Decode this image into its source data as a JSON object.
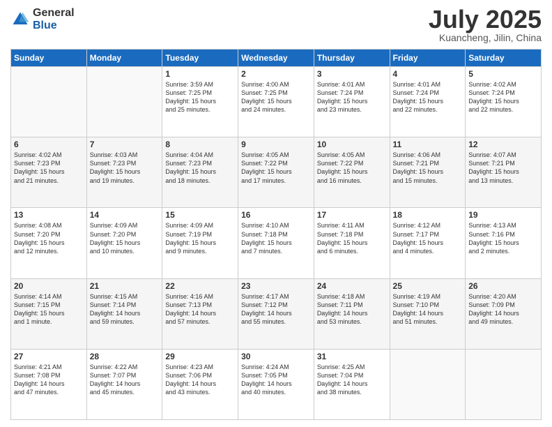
{
  "logo": {
    "general": "General",
    "blue": "Blue"
  },
  "header": {
    "month": "July 2025",
    "location": "Kuancheng, Jilin, China"
  },
  "days_of_week": [
    "Sunday",
    "Monday",
    "Tuesday",
    "Wednesday",
    "Thursday",
    "Friday",
    "Saturday"
  ],
  "weeks": [
    [
      {
        "day": "",
        "info": ""
      },
      {
        "day": "",
        "info": ""
      },
      {
        "day": "1",
        "info": "Sunrise: 3:59 AM\nSunset: 7:25 PM\nDaylight: 15 hours\nand 25 minutes."
      },
      {
        "day": "2",
        "info": "Sunrise: 4:00 AM\nSunset: 7:25 PM\nDaylight: 15 hours\nand 24 minutes."
      },
      {
        "day": "3",
        "info": "Sunrise: 4:01 AM\nSunset: 7:24 PM\nDaylight: 15 hours\nand 23 minutes."
      },
      {
        "day": "4",
        "info": "Sunrise: 4:01 AM\nSunset: 7:24 PM\nDaylight: 15 hours\nand 22 minutes."
      },
      {
        "day": "5",
        "info": "Sunrise: 4:02 AM\nSunset: 7:24 PM\nDaylight: 15 hours\nand 22 minutes."
      }
    ],
    [
      {
        "day": "6",
        "info": "Sunrise: 4:02 AM\nSunset: 7:23 PM\nDaylight: 15 hours\nand 21 minutes."
      },
      {
        "day": "7",
        "info": "Sunrise: 4:03 AM\nSunset: 7:23 PM\nDaylight: 15 hours\nand 19 minutes."
      },
      {
        "day": "8",
        "info": "Sunrise: 4:04 AM\nSunset: 7:23 PM\nDaylight: 15 hours\nand 18 minutes."
      },
      {
        "day": "9",
        "info": "Sunrise: 4:05 AM\nSunset: 7:22 PM\nDaylight: 15 hours\nand 17 minutes."
      },
      {
        "day": "10",
        "info": "Sunrise: 4:05 AM\nSunset: 7:22 PM\nDaylight: 15 hours\nand 16 minutes."
      },
      {
        "day": "11",
        "info": "Sunrise: 4:06 AM\nSunset: 7:21 PM\nDaylight: 15 hours\nand 15 minutes."
      },
      {
        "day": "12",
        "info": "Sunrise: 4:07 AM\nSunset: 7:21 PM\nDaylight: 15 hours\nand 13 minutes."
      }
    ],
    [
      {
        "day": "13",
        "info": "Sunrise: 4:08 AM\nSunset: 7:20 PM\nDaylight: 15 hours\nand 12 minutes."
      },
      {
        "day": "14",
        "info": "Sunrise: 4:09 AM\nSunset: 7:20 PM\nDaylight: 15 hours\nand 10 minutes."
      },
      {
        "day": "15",
        "info": "Sunrise: 4:09 AM\nSunset: 7:19 PM\nDaylight: 15 hours\nand 9 minutes."
      },
      {
        "day": "16",
        "info": "Sunrise: 4:10 AM\nSunset: 7:18 PM\nDaylight: 15 hours\nand 7 minutes."
      },
      {
        "day": "17",
        "info": "Sunrise: 4:11 AM\nSunset: 7:18 PM\nDaylight: 15 hours\nand 6 minutes."
      },
      {
        "day": "18",
        "info": "Sunrise: 4:12 AM\nSunset: 7:17 PM\nDaylight: 15 hours\nand 4 minutes."
      },
      {
        "day": "19",
        "info": "Sunrise: 4:13 AM\nSunset: 7:16 PM\nDaylight: 15 hours\nand 2 minutes."
      }
    ],
    [
      {
        "day": "20",
        "info": "Sunrise: 4:14 AM\nSunset: 7:15 PM\nDaylight: 15 hours\nand 1 minute."
      },
      {
        "day": "21",
        "info": "Sunrise: 4:15 AM\nSunset: 7:14 PM\nDaylight: 14 hours\nand 59 minutes."
      },
      {
        "day": "22",
        "info": "Sunrise: 4:16 AM\nSunset: 7:13 PM\nDaylight: 14 hours\nand 57 minutes."
      },
      {
        "day": "23",
        "info": "Sunrise: 4:17 AM\nSunset: 7:12 PM\nDaylight: 14 hours\nand 55 minutes."
      },
      {
        "day": "24",
        "info": "Sunrise: 4:18 AM\nSunset: 7:11 PM\nDaylight: 14 hours\nand 53 minutes."
      },
      {
        "day": "25",
        "info": "Sunrise: 4:19 AM\nSunset: 7:10 PM\nDaylight: 14 hours\nand 51 minutes."
      },
      {
        "day": "26",
        "info": "Sunrise: 4:20 AM\nSunset: 7:09 PM\nDaylight: 14 hours\nand 49 minutes."
      }
    ],
    [
      {
        "day": "27",
        "info": "Sunrise: 4:21 AM\nSunset: 7:08 PM\nDaylight: 14 hours\nand 47 minutes."
      },
      {
        "day": "28",
        "info": "Sunrise: 4:22 AM\nSunset: 7:07 PM\nDaylight: 14 hours\nand 45 minutes."
      },
      {
        "day": "29",
        "info": "Sunrise: 4:23 AM\nSunset: 7:06 PM\nDaylight: 14 hours\nand 43 minutes."
      },
      {
        "day": "30",
        "info": "Sunrise: 4:24 AM\nSunset: 7:05 PM\nDaylight: 14 hours\nand 40 minutes."
      },
      {
        "day": "31",
        "info": "Sunrise: 4:25 AM\nSunset: 7:04 PM\nDaylight: 14 hours\nand 38 minutes."
      },
      {
        "day": "",
        "info": ""
      },
      {
        "day": "",
        "info": ""
      }
    ]
  ]
}
